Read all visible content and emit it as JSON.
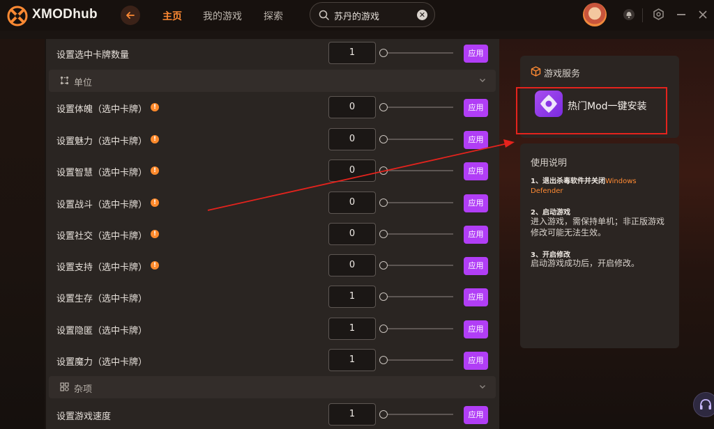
{
  "app": {
    "brand": "XMODhub"
  },
  "nav": {
    "home": "主页",
    "my_games": "我的游戏",
    "explore": "探索"
  },
  "search": {
    "value": "苏丹的游戏",
    "clear": "✕"
  },
  "panel": {
    "top_row": {
      "label": "设置选中卡牌数量",
      "value": "1",
      "apply": "应用"
    },
    "section_unit": "单位",
    "unit_rows": [
      {
        "label": "设置体魄（选中卡牌）",
        "value": "0",
        "apply": "应用",
        "info": true
      },
      {
        "label": "设置魅力（选中卡牌）",
        "value": "0",
        "apply": "应用",
        "info": true
      },
      {
        "label": "设置智慧（选中卡牌）",
        "value": "0",
        "apply": "应用",
        "info": true
      },
      {
        "label": "设置战斗（选中卡牌）",
        "value": "0",
        "apply": "应用",
        "info": true
      },
      {
        "label": "设置社交（选中卡牌）",
        "value": "0",
        "apply": "应用",
        "info": true
      },
      {
        "label": "设置支持（选中卡牌）",
        "value": "0",
        "apply": "应用",
        "info": true
      },
      {
        "label": "设置生存（选中卡牌）",
        "value": "1",
        "apply": "应用",
        "info": false
      },
      {
        "label": "设置隐匿（选中卡牌）",
        "value": "1",
        "apply": "应用",
        "info": false
      },
      {
        "label": "设置魔力（选中卡牌）",
        "value": "1",
        "apply": "应用",
        "info": false
      }
    ],
    "section_misc": "杂项",
    "misc_row": {
      "label": "设置游戏速度",
      "value": "1",
      "apply": "应用"
    }
  },
  "services": {
    "title": "游戏服务",
    "mod_label": "热门Mod一键安装"
  },
  "guide": {
    "title": "使用说明",
    "step1_head": "1、退出杀毒软件并关闭",
    "step1_highlight": "Windows Defender",
    "step2_head": "2、启动游戏",
    "step2_text": "进入游戏，需保持单机；非正版游戏修改可能无法生效。",
    "step3_head": "3、开启修改",
    "step3_text": "启动游戏成功后，开启修改。"
  },
  "colors": {
    "accent": "#ff8a33",
    "apply": "#b13ef6",
    "highlight_box": "#e5231d"
  }
}
